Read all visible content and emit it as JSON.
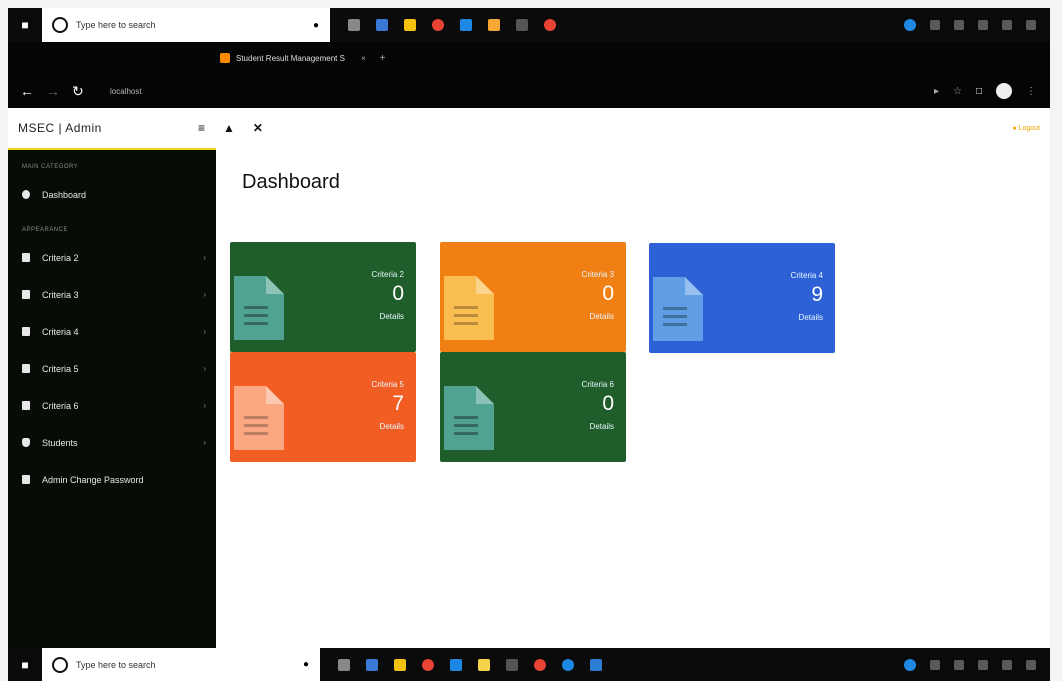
{
  "taskbar": {
    "search_placeholder": "Type here to search"
  },
  "browser": {
    "tab_title": "Student Result Management S",
    "url": "localhost"
  },
  "app": {
    "brand": "MSEC | Admin",
    "logout_label": "Logout"
  },
  "sidebar": {
    "main_heading": "MAIN CATEGORY",
    "dashboard": "Dashboard",
    "apps_heading": "APPEARANCE",
    "items": [
      {
        "label": "Criteria 2"
      },
      {
        "label": "Criteria 3"
      },
      {
        "label": "Criteria 4"
      },
      {
        "label": "Criteria 5"
      },
      {
        "label": "Criteria 6"
      },
      {
        "label": "Students"
      },
      {
        "label": "Admin Change Password"
      }
    ]
  },
  "main": {
    "title": "Dashboard"
  },
  "cards": [
    {
      "label": "Criteria 2",
      "value": "0",
      "details": "Details",
      "color": "#1f5e2a"
    },
    {
      "label": "Criteria 3",
      "value": "0",
      "details": "Details",
      "color": "#f07f14"
    },
    {
      "label": "Criteria 4",
      "value": "9",
      "details": "Details",
      "color": "#2f61d6"
    },
    {
      "label": "Criteria 5",
      "value": "7",
      "details": "Details",
      "color": "#f15d22"
    },
    {
      "label": "Criteria 6",
      "value": "0",
      "details": "Details",
      "color": "#1f5e2a"
    }
  ],
  "accents": {
    "gold": "#f2d21b",
    "sidebar": "#060d06"
  }
}
